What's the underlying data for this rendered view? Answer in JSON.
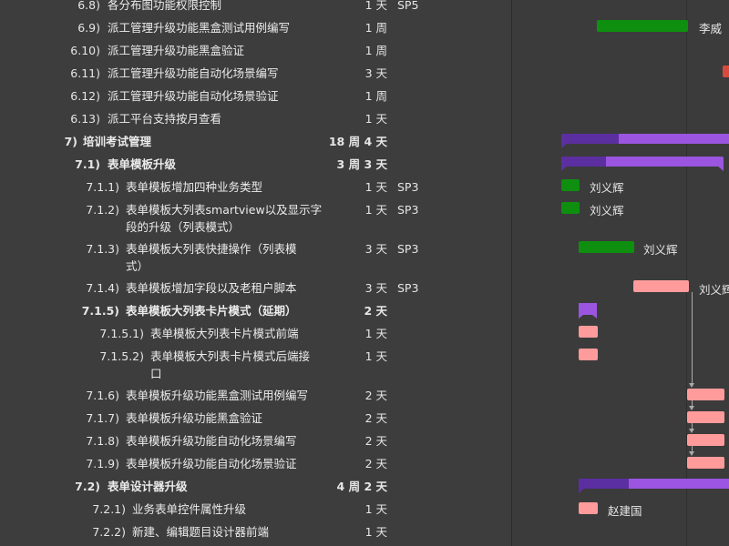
{
  "colors": {
    "outline_bg": "#3d3d3d",
    "chart_bg": "#3b3b3b",
    "bar_green": "#0f8f0f",
    "bar_salmon": "#ff9b9b",
    "bar_red": "#d94a3c",
    "group_purple": "#9b55e0",
    "group_done": "#5b2fa0"
  },
  "tasks": [
    {
      "num": "6.8)",
      "title": "各分布图功能权限控制",
      "dur": "1 天",
      "sp": "SP5"
    },
    {
      "num": "6.9)",
      "title": "派工管理升级功能黑盒测试用例编写",
      "dur": "1 周",
      "sp": ""
    },
    {
      "num": "6.10)",
      "title": "派工管理升级功能黑盒验证",
      "dur": "1 周",
      "sp": ""
    },
    {
      "num": "6.11)",
      "title": "派工管理升级功能自动化场景编写",
      "dur": "3 天",
      "sp": ""
    },
    {
      "num": "6.12)",
      "title": "派工管理升级功能自动化场景验证",
      "dur": "1 周",
      "sp": ""
    },
    {
      "num": "6.13)",
      "title": "派工平台支持按月查看",
      "dur": "1 天",
      "sp": ""
    },
    {
      "num": "7)",
      "title": "培训考试管理",
      "dur": "18 周 4 天",
      "sp": ""
    },
    {
      "num": "7.1)",
      "title": "表单模板升级",
      "dur": "3 周 3 天",
      "sp": ""
    },
    {
      "num": "7.1.1)",
      "title": "表单模板增加四种业务类型",
      "dur": "1 天",
      "sp": "SP3"
    },
    {
      "num": "7.1.2)",
      "title": "表单模板大列表smartview以及显示字",
      "title2": "段的升级（列表模式）",
      "dur": "1 天",
      "sp": "SP3"
    },
    {
      "num": "7.1.3)",
      "title": "表单模板大列表快捷操作（列表模",
      "title2": "式）",
      "dur": "3 天",
      "sp": "SP3"
    },
    {
      "num": "7.1.4)",
      "title": "表单模板增加字段以及老租户脚本",
      "dur": "3 天",
      "sp": "SP3"
    },
    {
      "num": "7.1.5)",
      "title": "表单模板大列表卡片模式（延期）",
      "dur": "2 天",
      "sp": ""
    },
    {
      "num": "7.1.5.1)",
      "title": "表单模板大列表卡片模式前端",
      "dur": "1 天",
      "sp": ""
    },
    {
      "num": "7.1.5.2)",
      "title": "表单模板大列表卡片模式后端接",
      "title2": "口",
      "dur": "1 天",
      "sp": ""
    },
    {
      "num": "7.1.6)",
      "title": "表单模板升级功能黑盒测试用例编写",
      "dur": "2 天",
      "sp": ""
    },
    {
      "num": "7.1.7)",
      "title": "表单模板升级功能黑盒验证",
      "dur": "2 天",
      "sp": ""
    },
    {
      "num": "7.1.8)",
      "title": "表单模板升级功能自动化场景编写",
      "dur": "2 天",
      "sp": ""
    },
    {
      "num": "7.1.9)",
      "title": "表单模板升级功能自动化场景验证",
      "dur": "2 天",
      "sp": ""
    },
    {
      "num": "7.2)",
      "title": "表单设计器升级",
      "dur": "4 周 2 天",
      "sp": ""
    },
    {
      "num": "7.2.1)",
      "title": "业务表单控件属性升级",
      "dur": "1 天",
      "sp": ""
    },
    {
      "num": "7.2.2)",
      "title": "新建、编辑题目设计器前端",
      "dur": "1 天",
      "sp": ""
    }
  ],
  "resources": {
    "r1": "李威",
    "r2": "刘义辉",
    "r3": "刘义辉",
    "r4": "刘义辉",
    "r5": "刘义辉",
    "r6": "赵建国"
  }
}
